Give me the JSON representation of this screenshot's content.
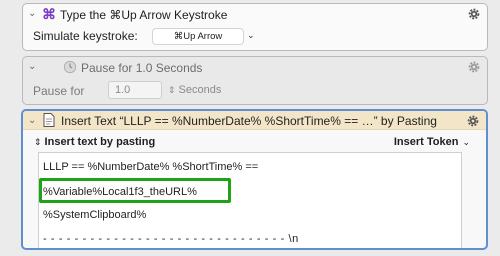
{
  "action1": {
    "title": "Type the ⌘Up Arrow Keystroke",
    "label": "Simulate keystroke:",
    "keystroke": "⌘Up Arrow",
    "icon": "command-icon"
  },
  "action2": {
    "title": "Pause for 1.0 Seconds",
    "label": "Pause for",
    "value": "1.0",
    "unit": "Seconds",
    "icon": "clock-icon"
  },
  "action3": {
    "title": "Insert Text “LLLP == %NumberDate% %ShortTime% == …” by Pasting",
    "mode_label": "Insert text by pasting",
    "insert_token_label": "Insert Token",
    "text_lines": [
      "LLLP == %NumberDate% %ShortTime% ==",
      "%Variable%Local1f3_theURL%",
      "%SystemClipboard%",
      "- - - - - - - - - - - - - - - - - - - - - - - - - - - - - - - \\n"
    ],
    "highlight_color": "#1ea21a"
  },
  "colors": {
    "selection_border": "#5f8fd0",
    "header_selected": "#f3e6c8",
    "command_glyph": "#7a3ec4"
  }
}
